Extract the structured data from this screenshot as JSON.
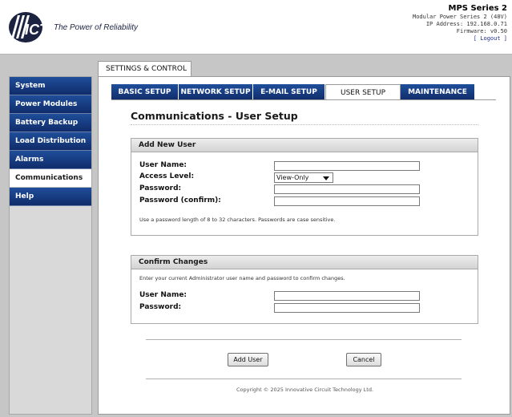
{
  "brand": {
    "tagline": "The Power of Reliability",
    "logo_icon": "ict-logo-icon"
  },
  "product": {
    "series": "MPS Series 2",
    "model": "Modular Power Series 2 (48V)",
    "ip": "IP Address: 192.168.0.71",
    "firmware": "Firmware: v0.50",
    "logout": "[ Logout ]"
  },
  "sidebar": {
    "items": [
      {
        "label": "System"
      },
      {
        "label": "Power Modules"
      },
      {
        "label": "Battery Backup"
      },
      {
        "label": "Load Distribution"
      },
      {
        "label": "Alarms"
      },
      {
        "label": "Communications",
        "active": true
      },
      {
        "label": "Help"
      }
    ]
  },
  "top_tab": "SETTINGS & CONTROL",
  "tabs": [
    {
      "label": "BASIC SETUP"
    },
    {
      "label": "NETWORK SETUP"
    },
    {
      "label": "E-MAIL SETUP"
    },
    {
      "label": "USER SETUP",
      "active": true
    },
    {
      "label": "MAINTENANCE"
    }
  ],
  "page_title": "Communications - User Setup",
  "add_user": {
    "heading": "Add New User",
    "user_name_label": "User Name:",
    "access_level_label": "Access Level:",
    "access_level_value": "View-Only",
    "password_label": "Password:",
    "password_confirm_label": "Password (confirm):",
    "note": "Use a password length of 8 to 32 characters. Passwords are case sensitive."
  },
  "confirm": {
    "heading": "Confirm Changes",
    "note": "Enter your current Administrator user name and password to confirm changes.",
    "user_name_label": "User Name:",
    "password_label": "Password:"
  },
  "buttons": {
    "add_user": "Add User",
    "cancel": "Cancel"
  },
  "copyright": "Copyright © 2025 Innovative Circuit Technology Ltd.",
  "colors": {
    "nav_blue": "#16387f",
    "background_gray": "#c6c6c6"
  }
}
